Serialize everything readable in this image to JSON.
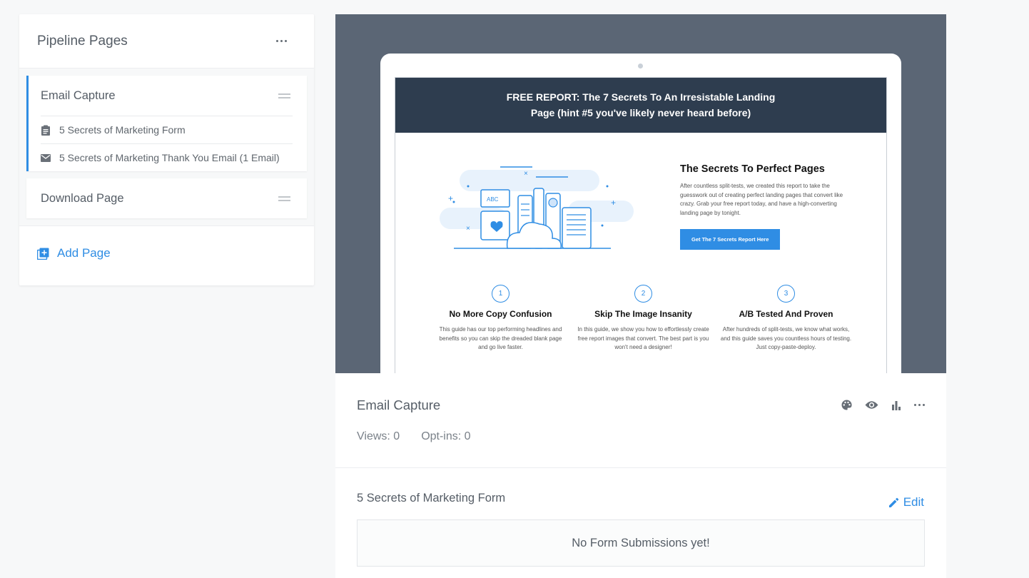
{
  "sidebar": {
    "title": "Pipeline Pages",
    "pages": [
      {
        "title": "Email Capture",
        "active": true,
        "items": [
          {
            "icon": "form-icon",
            "label": "5 Secrets of Marketing Form"
          },
          {
            "icon": "email-icon",
            "label": "5 Secrets of Marketing Thank You Email (1 Email)"
          }
        ]
      },
      {
        "title": "Download Page",
        "active": false,
        "items": []
      }
    ],
    "add_page_label": "Add Page"
  },
  "preview": {
    "banner_line1": "FREE REPORT: The 7 Secrets To An Irresistable Landing",
    "banner_line2": "Page (hint #5 you've likely never heard before)",
    "heading": "The Secrets To Perfect Pages",
    "body": "After countless split-tests, we created this report to take the guesswork out of creating perfect landing pages that convert like crazy. Grab your free report today, and have a high-converting landing page by tonight.",
    "cta": "Get The 7 Secrets Report Here",
    "illustration_label": "ABC",
    "features": [
      {
        "num": "1",
        "title": "No More Copy Confusion",
        "text": "This guide has our top performing headlines and benefits so you can skip the dreaded blank page and go live faster."
      },
      {
        "num": "2",
        "title": "Skip The Image Insanity",
        "text": "In this guide, we show you how to effortlessly create free report images that convert. The best part is you won't need a designer!"
      },
      {
        "num": "3",
        "title": "A/B Tested And Proven",
        "text": "After hundreds of split-tests, we know what works, and this guide saves you countless hours of testing. Just copy-paste-deploy."
      }
    ]
  },
  "details": {
    "title": "Email Capture",
    "views": "Views: 0",
    "optins": "Opt-ins: 0",
    "icons": [
      "palette-icon",
      "eye-icon",
      "bar-chart-icon",
      "more-icon"
    ]
  },
  "form_section": {
    "title": "5 Secrets of Marketing Form",
    "edit_label": "Edit",
    "empty_message": "No Form Submissions yet!"
  },
  "colors": {
    "accent": "#2f8de4",
    "preview_bg": "#5b6675",
    "banner_bg": "#2e3d4f"
  }
}
